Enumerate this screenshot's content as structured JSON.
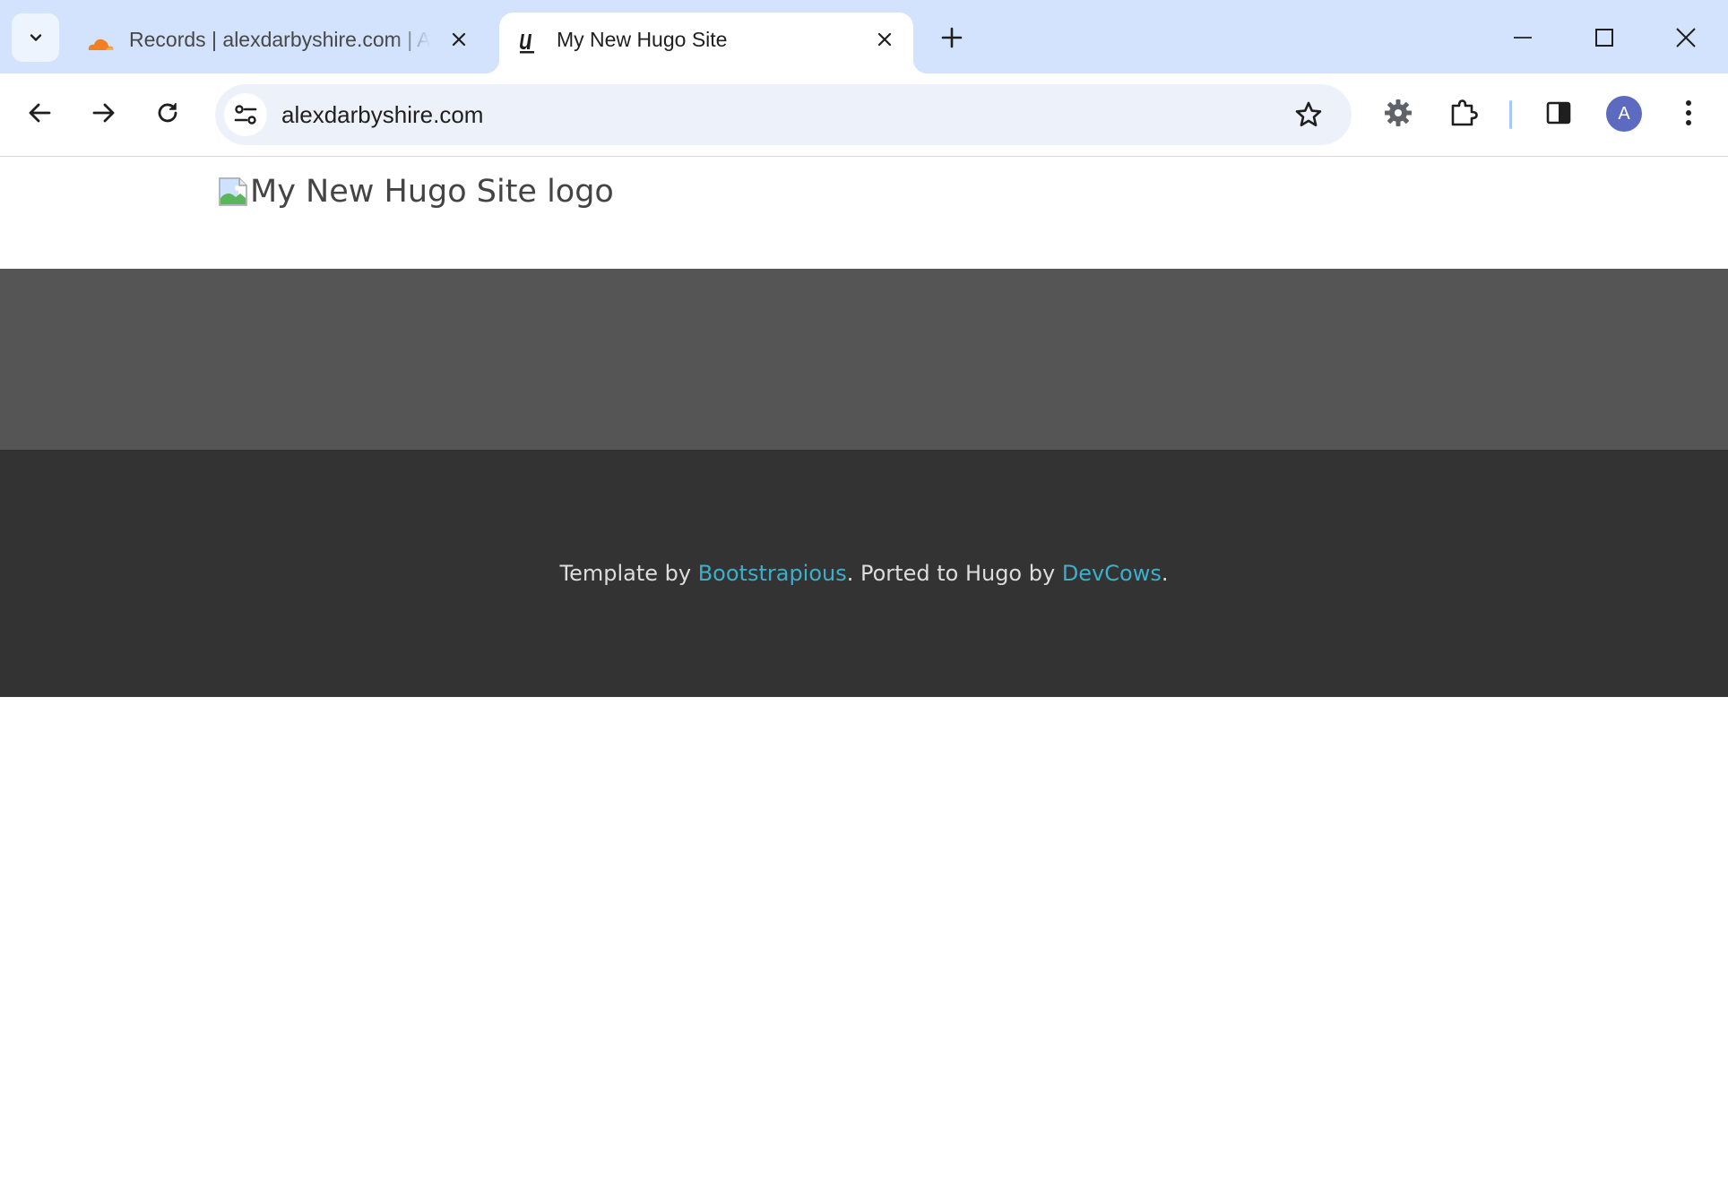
{
  "browser": {
    "tabs": [
      {
        "title": "Records | alexdarbyshire.com | A",
        "favicon": "cloudflare-icon",
        "active": false
      },
      {
        "title": "My New Hugo Site",
        "favicon": "hugo-icon",
        "active": true
      }
    ],
    "address_bar": {
      "url": "alexdarbyshire.com"
    },
    "profile_initial": "A",
    "colors": {
      "tabstrip": "#d3e3fd",
      "omnibox": "#edf1f9",
      "avatar": "#5c6bc0"
    }
  },
  "page": {
    "logo_alt": "My New Hugo Site logo",
    "footer": {
      "template_prefix": "Template by ",
      "template_link": "Bootstrapious",
      "ported_text": ". Ported to Hugo by ",
      "ported_link": "DevCows",
      "suffix": "."
    },
    "colors": {
      "hero": "#555555",
      "footer_bg": "#333333",
      "link": "#3ab0cc",
      "footer_text": "#dddddd"
    }
  }
}
